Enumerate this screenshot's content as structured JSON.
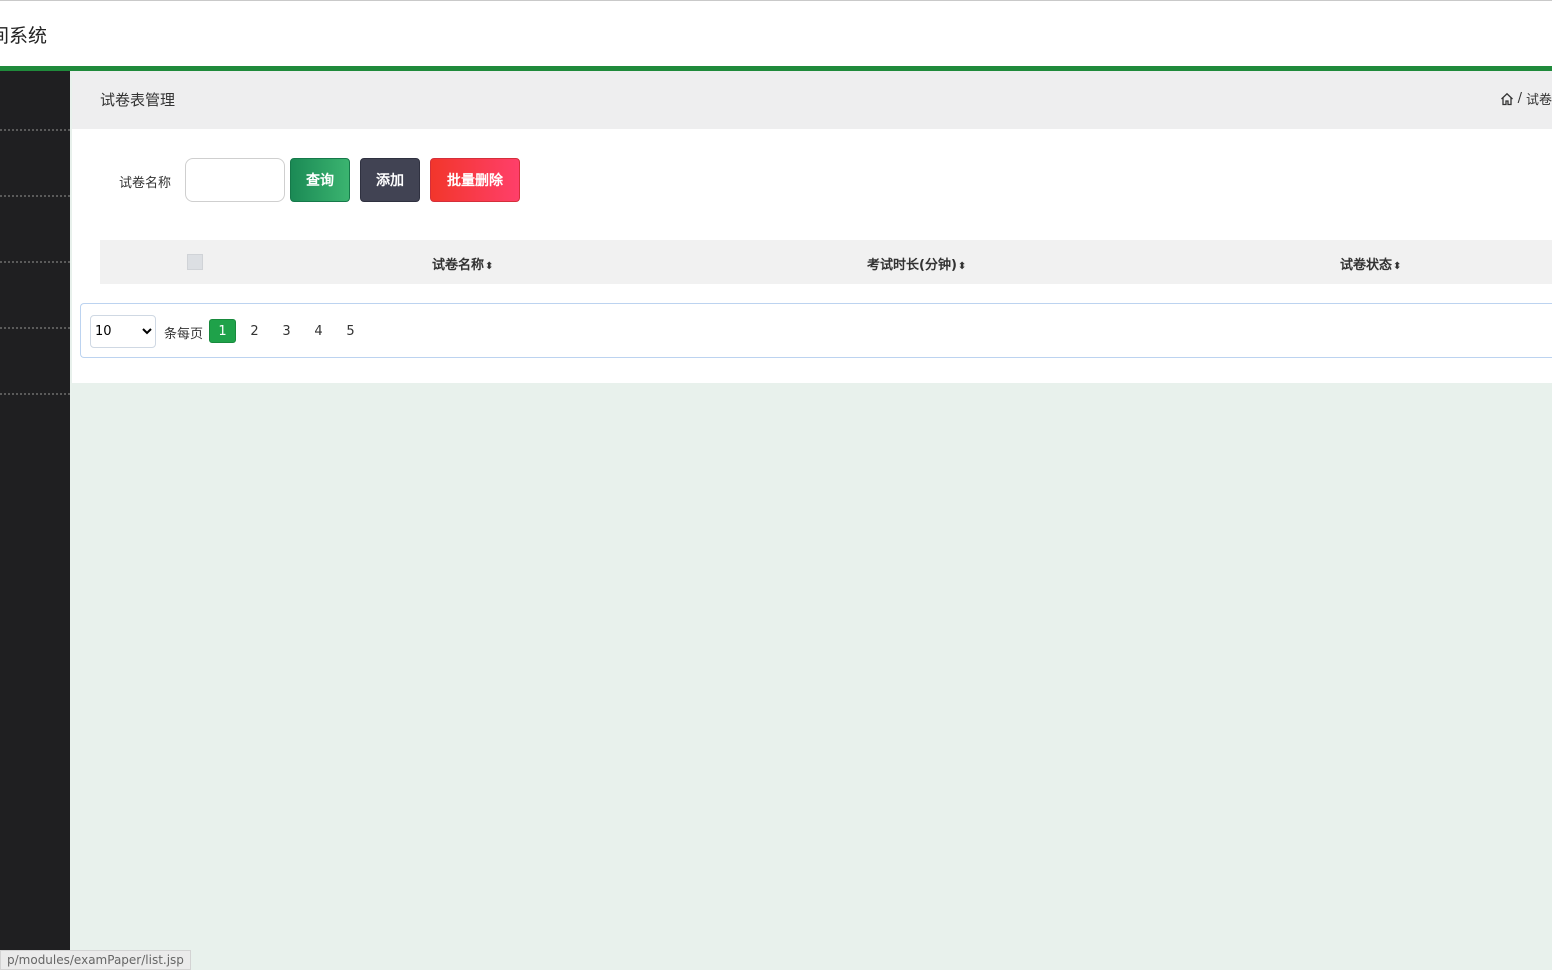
{
  "app": {
    "title": "间系统"
  },
  "colors": {
    "accent": "#1f8a3b",
    "sidebar": "#1f1f21",
    "query": "#1b8a55",
    "add": "#414353",
    "delete": "#f2362b"
  },
  "page": {
    "title": "试卷表管理",
    "breadcrumb": {
      "separator": "/",
      "current": "试卷"
    }
  },
  "search": {
    "label": "试卷名称",
    "value": "",
    "query_label": "查询",
    "add_label": "添加",
    "batch_delete_label": "批量删除"
  },
  "table": {
    "sort_icon": "⬍",
    "columns": [
      "试卷名称",
      "考试时长(分钟)",
      "试卷状态"
    ]
  },
  "pagination": {
    "page_size": "10",
    "page_size_options": [
      "10"
    ],
    "per_page_label": "条每页",
    "pages": [
      "1",
      "2",
      "3",
      "4",
      "5"
    ],
    "current": "1"
  },
  "status_bar": {
    "url": "p/modules/examPaper/list.jsp"
  }
}
